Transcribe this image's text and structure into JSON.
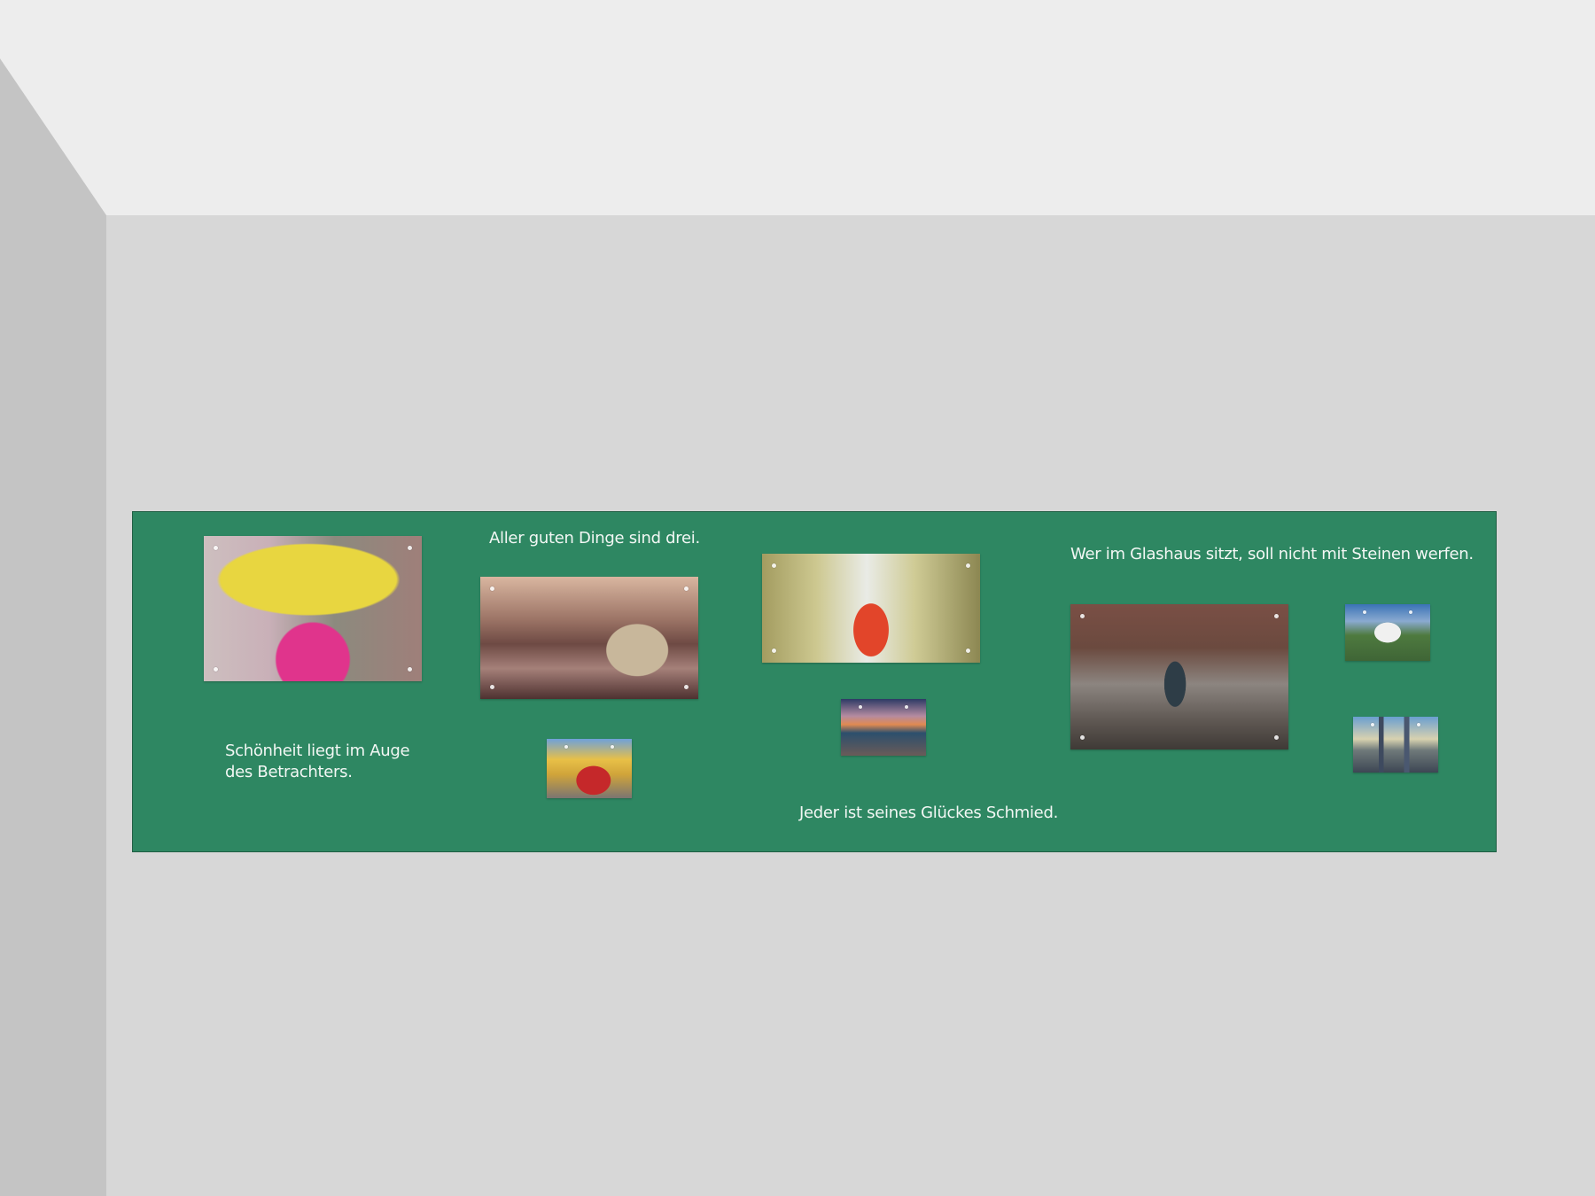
{
  "panel": {
    "color": "#2e8762",
    "quotes": {
      "q1": "Schönheit liegt im Auge\ndes Betrachters.",
      "q2": "Aller guten Dinge sind drei.",
      "q3": "Jeder ist seines Glückes Schmied.",
      "q4": "Wer im Glashaus sitzt, soll nicht mit Steinen werfen."
    }
  }
}
